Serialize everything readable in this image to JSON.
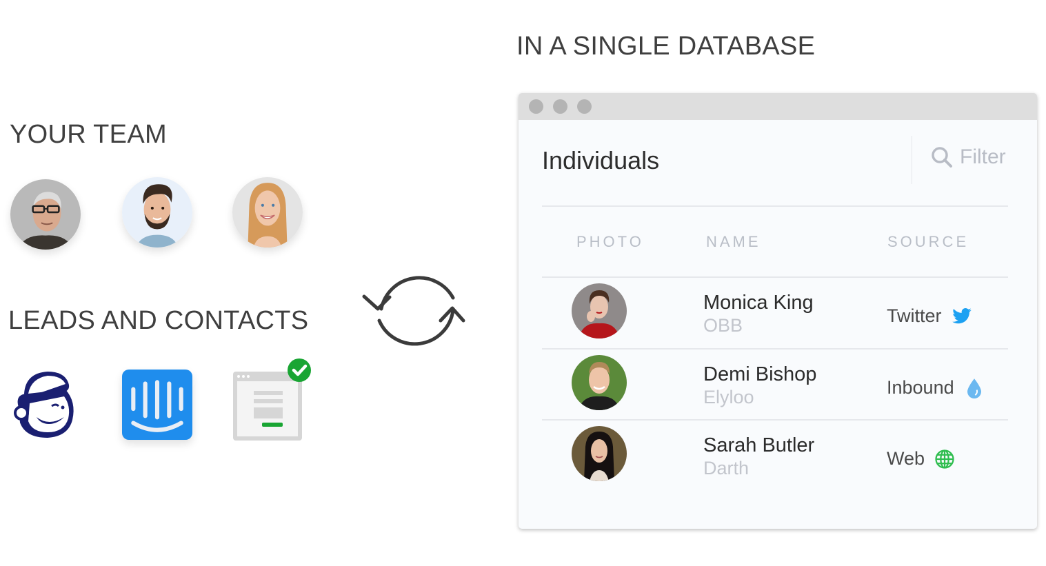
{
  "headings": {
    "team": "YOUR TEAM",
    "leads": "LEADS AND CONTACTS",
    "database": "IN A SINGLE DATABASE"
  },
  "team_members": [
    {
      "icon": "team-member-photo-older-man-glasses"
    },
    {
      "icon": "team-member-photo-young-man-beard"
    },
    {
      "icon": "team-member-photo-blonde-woman"
    }
  ],
  "lead_sources": [
    {
      "name": "Mailchimp",
      "icon": "mailchimp-logo-icon"
    },
    {
      "name": "Intercom",
      "icon": "intercom-logo-icon",
      "color": "#1f8ded"
    },
    {
      "name": "Web form",
      "icon": "web-form-check-icon",
      "badge_color": "#19a533"
    }
  ],
  "sync_icon": "sync-arrows-icon",
  "window": {
    "title": "Individuals",
    "filter": {
      "label": "Filter",
      "icon": "search-icon"
    },
    "columns": [
      "PHOTO",
      "NAME",
      "SOURCE"
    ],
    "rows": [
      {
        "name": "Monica King",
        "company": "OBB",
        "source": "Twitter",
        "source_icon": "twitter-bird-icon",
        "source_color": "#1da1f2"
      },
      {
        "name": "Demi Bishop",
        "company": "Elyloo",
        "source": "Inbound",
        "source_icon": "water-drop-icon",
        "source_color": "#6bb8f0"
      },
      {
        "name": "Sarah Butler",
        "company": "Darth",
        "source": "Web",
        "source_icon": "globe-icon",
        "source_color": "#2ebd4e"
      }
    ]
  }
}
